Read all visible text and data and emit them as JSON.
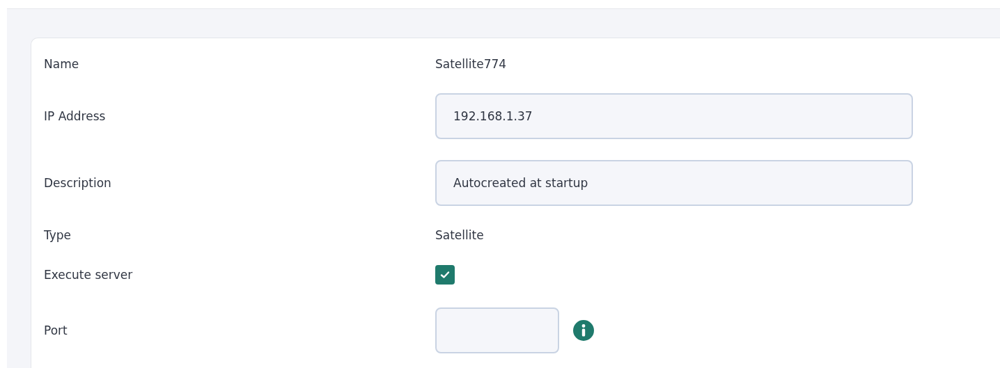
{
  "fields": [
    {
      "kind": "text",
      "label": "Name",
      "value": "Satellite774"
    },
    {
      "kind": "input",
      "label": "IP Address",
      "value": "192.168.1.37"
    },
    {
      "kind": "input",
      "label": "Description",
      "value": "Autocreated at startup"
    },
    {
      "kind": "text",
      "label": "Type",
      "value": "Satellite"
    },
    {
      "kind": "checkbox",
      "label": "Execute server",
      "checked": true
    },
    {
      "kind": "short-input",
      "label": "Port"
    }
  ]
}
